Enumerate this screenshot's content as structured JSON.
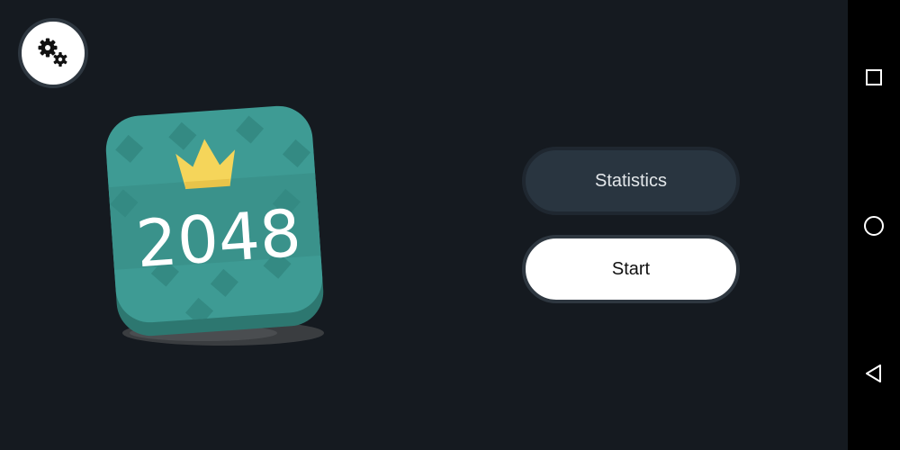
{
  "logo": {
    "text": "2048",
    "tile_color": "#3e9b94",
    "crown_color": "#f5d55a"
  },
  "menu": {
    "statistics_label": "Statistics",
    "start_label": "Start"
  },
  "icons": {
    "settings": "gears-icon",
    "recents": "square-icon",
    "home": "circle-icon",
    "back": "triangle-back-icon"
  },
  "colors": {
    "background": "#151a20",
    "secondary_button": "#293540",
    "primary_button": "#ffffff",
    "nav_bar": "#000000"
  }
}
